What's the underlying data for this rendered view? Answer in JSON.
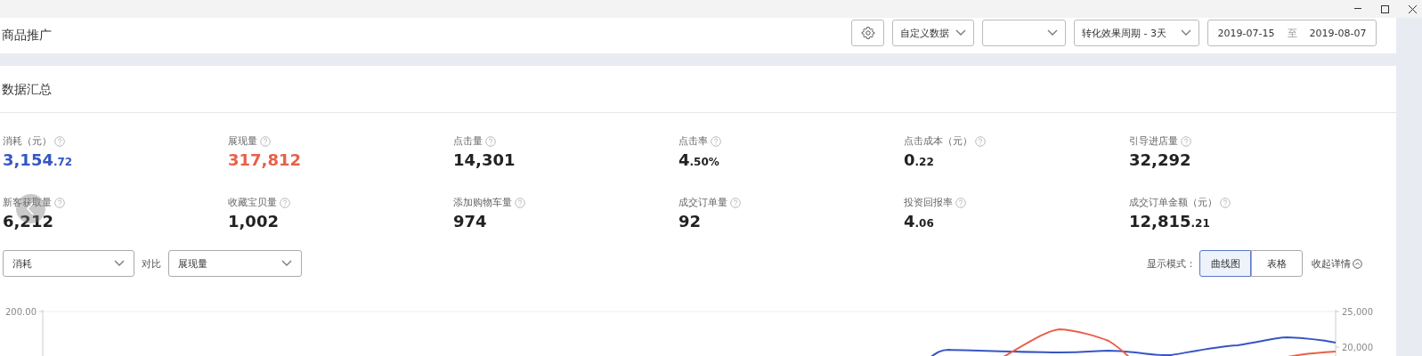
{
  "header": {
    "title": "商品推广",
    "dropdowns": [
      {
        "kind": "labeled",
        "label": "自定义数据"
      },
      {
        "kind": "blank"
      },
      {
        "kind": "labeled",
        "label": "转化效果周期 - 3天"
      }
    ],
    "date_range": {
      "start": "2019-07-15",
      "separator": "至",
      "end": "2019-08-07"
    }
  },
  "summary": {
    "title": "数据汇总",
    "metrics": [
      {
        "label": "消耗（元）",
        "value": "3,154",
        "decimal": ".72",
        "color": "#3656c4"
      },
      {
        "label": "展现量",
        "value": "317,812",
        "color": "#e8604a"
      },
      {
        "label": "点击量",
        "value": "14,301"
      },
      {
        "label": "点击率",
        "value": "4",
        "decimal": ".50%"
      },
      {
        "label": "点击成本（元）",
        "value": "0",
        "decimal": ".22"
      },
      {
        "label": "引导进店量",
        "value": "32,292"
      },
      {
        "label": "新客获取量",
        "value": "6,212"
      },
      {
        "label": "收藏宝贝量",
        "value": "1,002"
      },
      {
        "label": "添加购物车量",
        "value": "974"
      },
      {
        "label": "成交订单量",
        "value": "92"
      },
      {
        "label": "投资回报率",
        "value": "4",
        "decimal": ".06"
      },
      {
        "label": "成交订单金额（元）",
        "value": "12,815",
        "decimal": ".21"
      }
    ],
    "primary_select": "消耗",
    "compare_label": "对比",
    "compare_select": "展现量",
    "mode_label": "显示模式：",
    "modes": [
      {
        "label": "曲线图",
        "selected": true
      },
      {
        "label": "表格",
        "selected": false
      }
    ],
    "collapse_link": "收起详情",
    "chart": {
      "left_ticks": [
        "200.00"
      ],
      "right_ticks": [
        "25,000",
        "20,000"
      ]
    }
  }
}
